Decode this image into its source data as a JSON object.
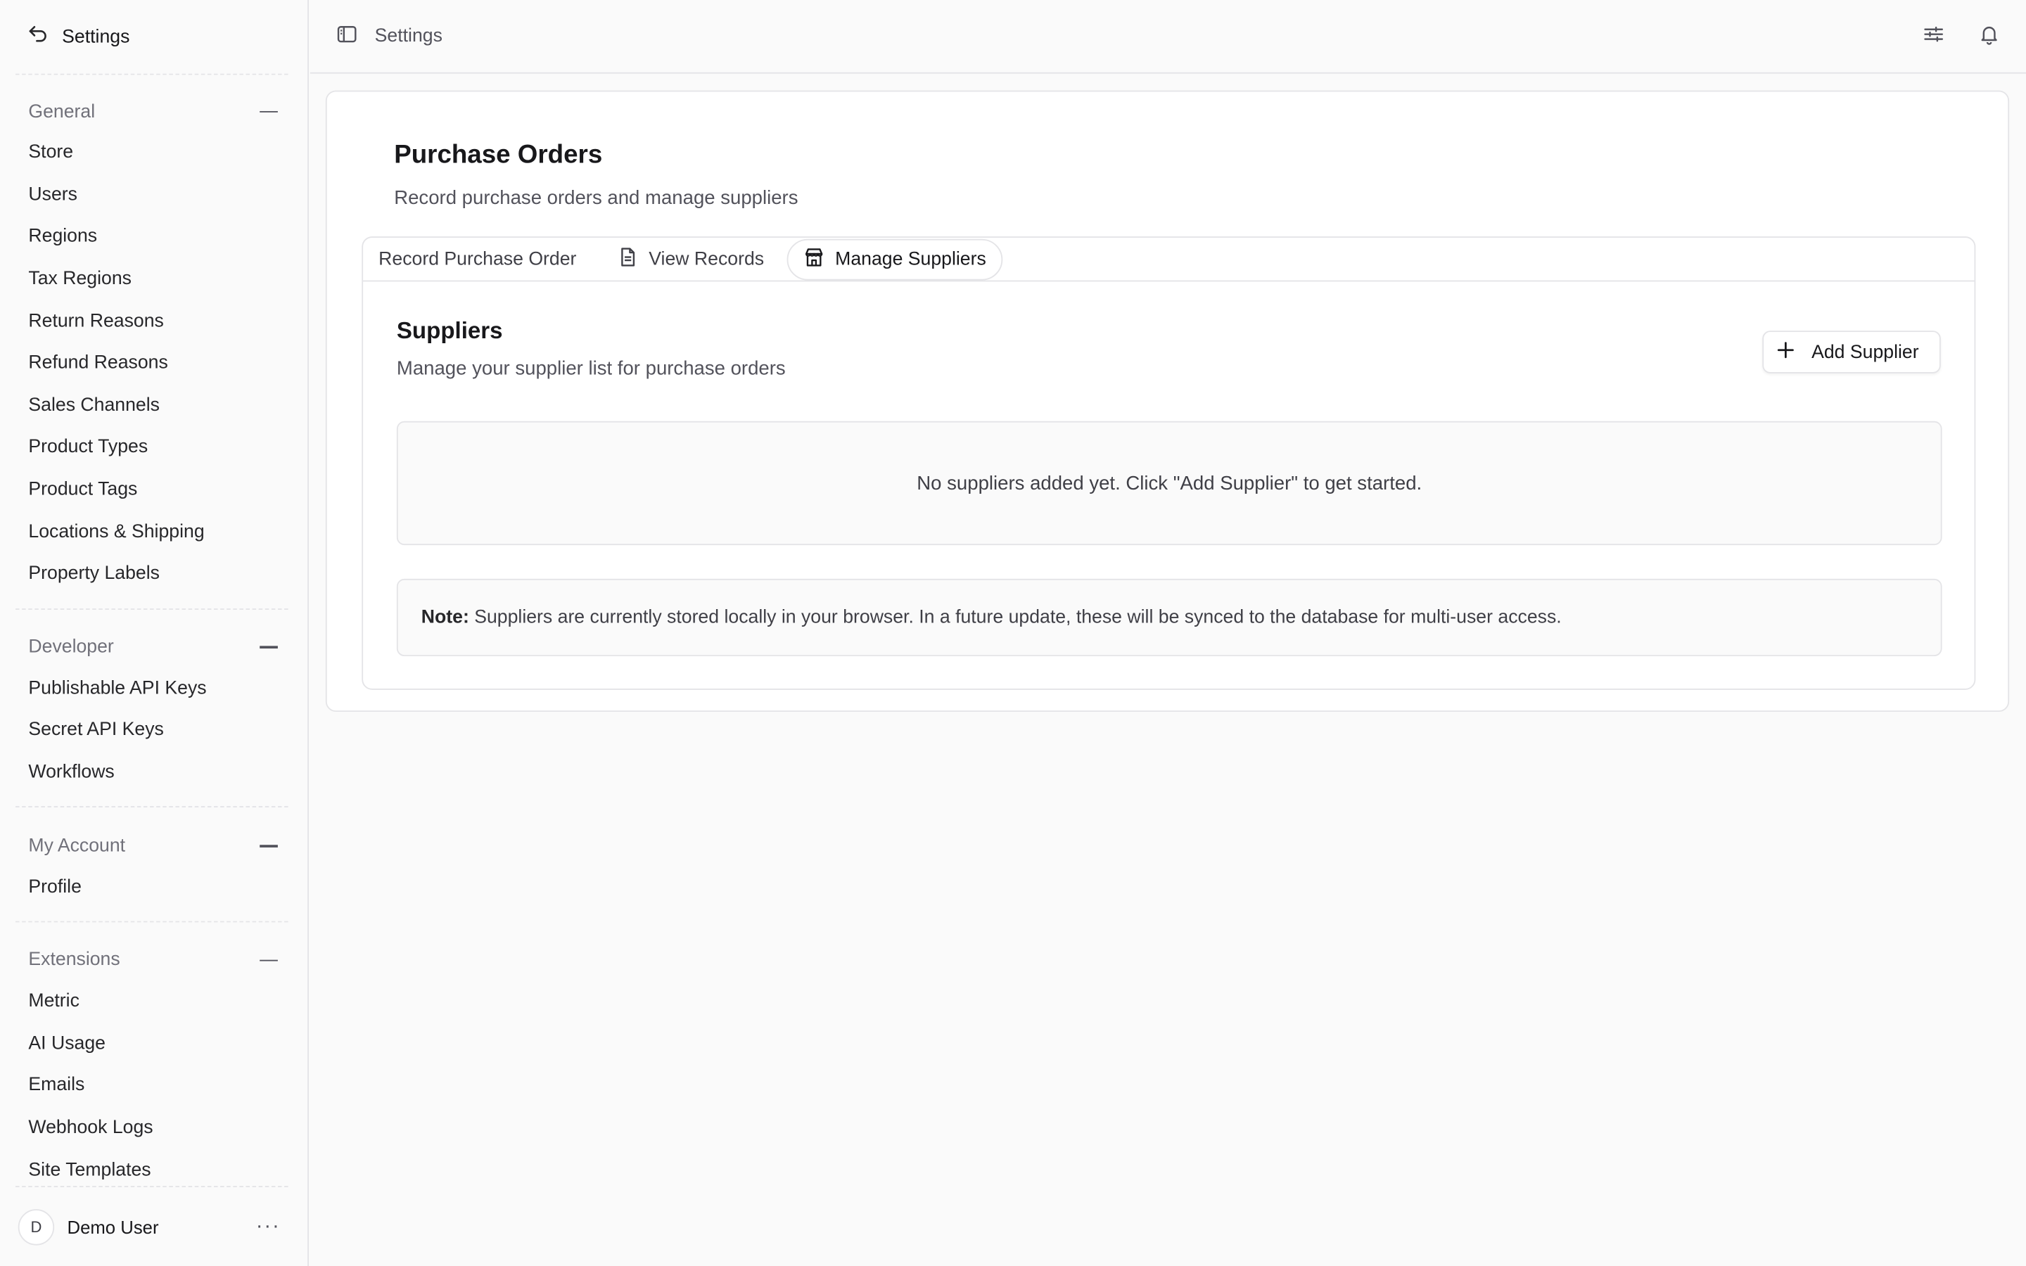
{
  "sidebar": {
    "title": "Settings",
    "groups": [
      {
        "label": "General",
        "items": [
          "Store",
          "Users",
          "Regions",
          "Tax Regions",
          "Return Reasons",
          "Refund Reasons",
          "Sales Channels",
          "Product Types",
          "Product Tags",
          "Locations & Shipping",
          "Property Labels"
        ]
      },
      {
        "label": "Developer",
        "items": [
          "Publishable API Keys",
          "Secret API Keys",
          "Workflows"
        ]
      },
      {
        "label": "My Account",
        "items": [
          "Profile"
        ]
      },
      {
        "label": "Extensions",
        "items": [
          "Metric",
          "AI Usage",
          "Emails",
          "Webhook Logs",
          "Site Templates"
        ]
      }
    ],
    "user": {
      "initial": "D",
      "name": "Demo User",
      "menu": "···"
    }
  },
  "topbar": {
    "breadcrumb": "Settings"
  },
  "main": {
    "title": "Purchase Orders",
    "subtitle": "Record purchase orders and manage suppliers",
    "tabs": [
      {
        "label": "Record Purchase Order",
        "icon": "none"
      },
      {
        "label": "View Records",
        "icon": "document-icon"
      },
      {
        "label": "Manage Suppliers",
        "icon": "store-icon",
        "active": true
      }
    ],
    "suppliers": {
      "title": "Suppliers",
      "subtitle": "Manage your supplier list for purchase orders",
      "add_button": "Add Supplier",
      "empty_text": "No suppliers added yet. Click \"Add Supplier\" to get started.",
      "note_label": "Note:",
      "note_text": "Suppliers are currently stored locally in your browser. In a future update, these will be synced to the database for multi-user access."
    }
  }
}
